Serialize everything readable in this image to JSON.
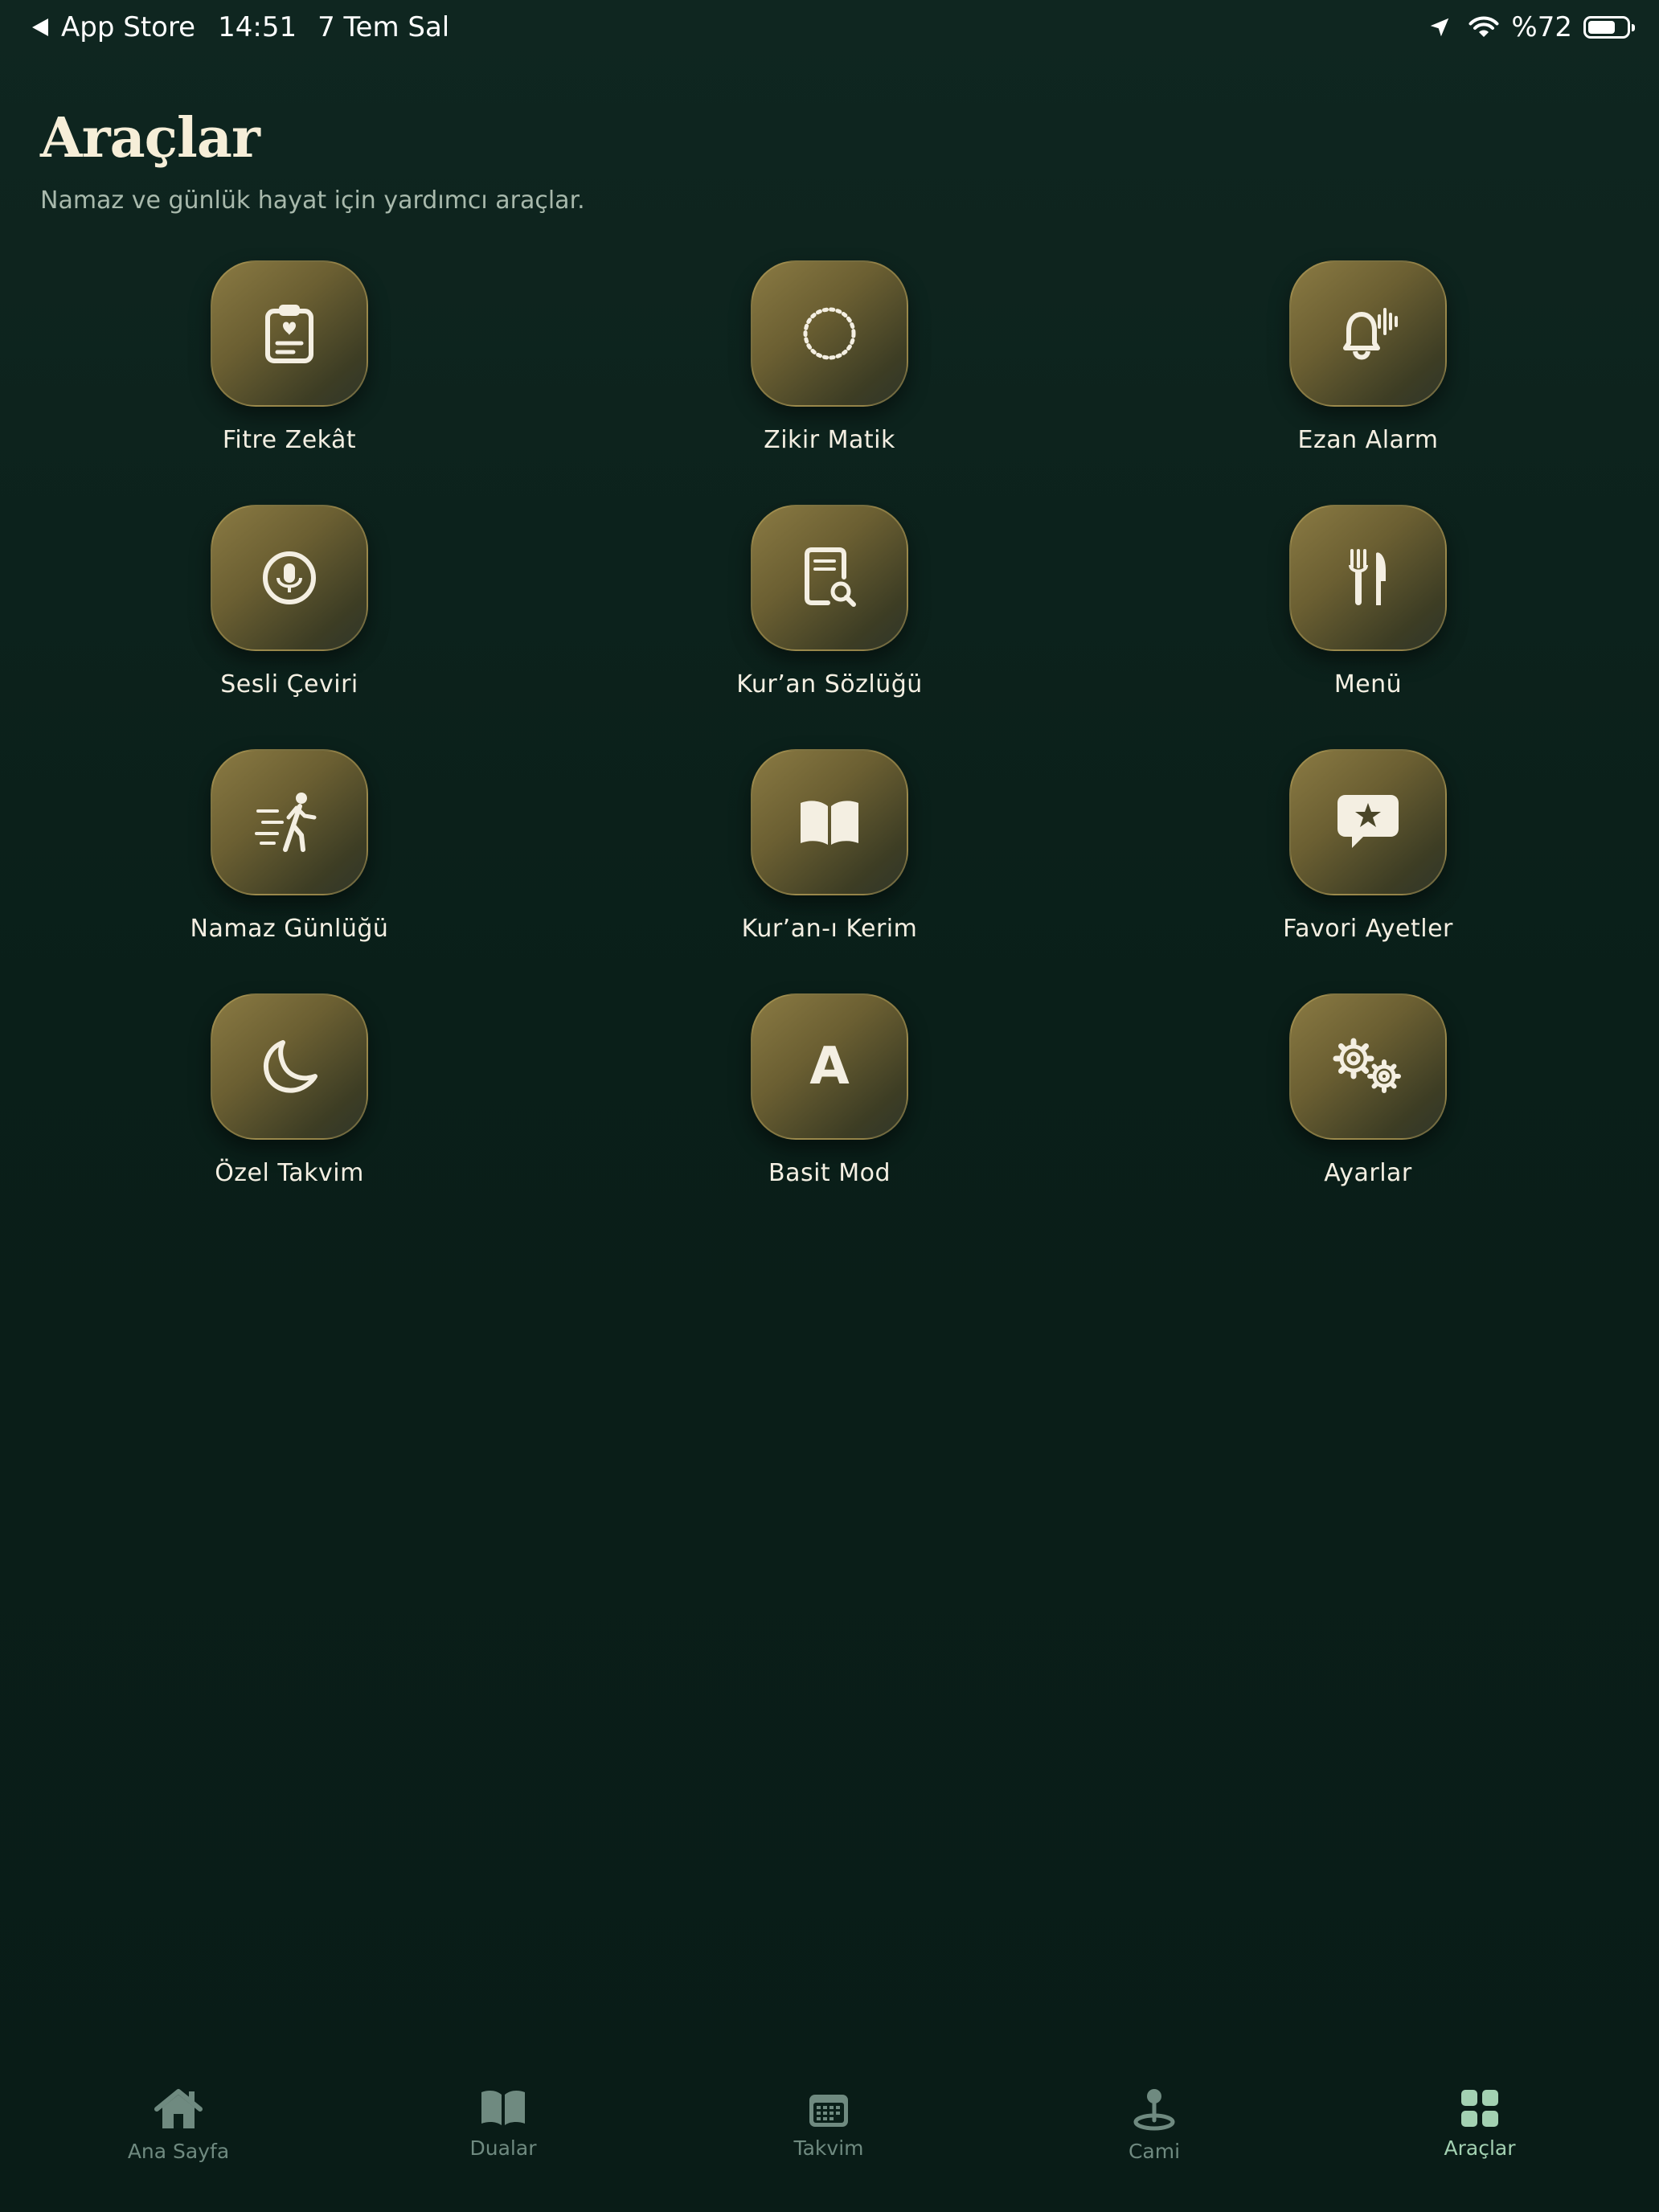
{
  "status_bar": {
    "back_app": "App Store",
    "time": "14:51",
    "date": "7 Tem Sal",
    "battery_text": "%72",
    "battery_level": 0.72
  },
  "header": {
    "title": "Araçlar",
    "subtitle": "Namaz ve günlük hayat için yardımcı araçlar."
  },
  "tools": [
    {
      "label": "Fitre Zekât",
      "icon": "clipboard-heart-icon"
    },
    {
      "label": "Zikir Matik",
      "icon": "dotted-circle-icon"
    },
    {
      "label": "Ezan Alarm",
      "icon": "bell-waves-icon"
    },
    {
      "label": "Sesli Çeviri",
      "icon": "microphone-circle-icon"
    },
    {
      "label": "Kur’an Sözlüğü",
      "icon": "document-search-icon"
    },
    {
      "label": "Menü",
      "icon": "fork-knife-icon"
    },
    {
      "label": "Namaz Günlüğü",
      "icon": "walking-figure-icon"
    },
    {
      "label": "Kur’an-ı Kerim",
      "icon": "open-book-icon"
    },
    {
      "label": "Favori Ayetler",
      "icon": "star-bubble-icon"
    },
    {
      "label": "Özel Takvim",
      "icon": "crescent-moon-icon"
    },
    {
      "label": "Basit Mod",
      "icon": "letter-a-icon",
      "glyph": "A"
    },
    {
      "label": "Ayarlar",
      "icon": "gears-icon"
    }
  ],
  "tab_bar": {
    "active": "Araçlar",
    "tabs": [
      {
        "label": "Ana Sayfa",
        "icon": "house-icon"
      },
      {
        "label": "Dualar",
        "icon": "book-icon"
      },
      {
        "label": "Takvim",
        "icon": "calendar-icon"
      },
      {
        "label": "Cami",
        "icon": "location-pin-icon"
      },
      {
        "label": "Araçlar",
        "icon": "grid-icon"
      }
    ]
  },
  "colors": {
    "background": "#0b211b",
    "tile_gold": "#8a7a43",
    "text_cream": "#f4efe2",
    "tab_inactive": "#6f8a80",
    "tab_active": "#a3d1b2"
  }
}
